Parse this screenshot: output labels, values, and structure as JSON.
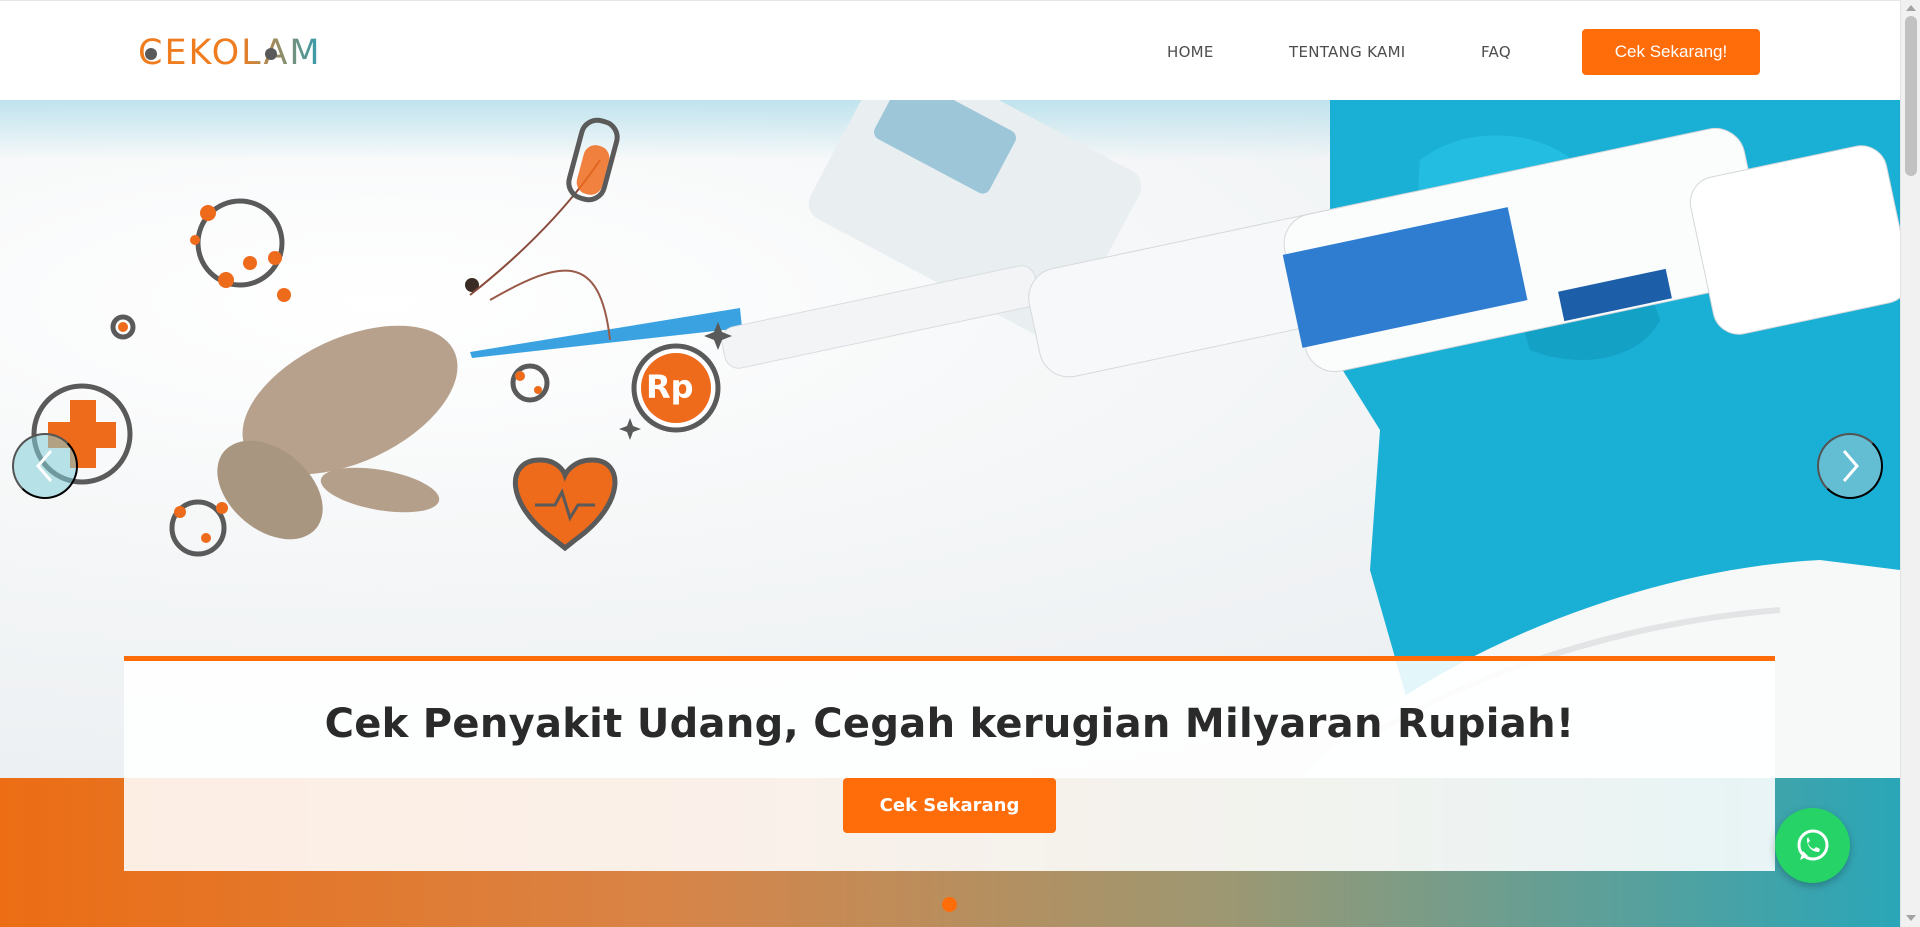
{
  "brand": {
    "logo_text": "CEKOLAM",
    "orange": "#ff6c0a",
    "teal": "#2f9db2"
  },
  "nav": {
    "home": "HOME",
    "about": "TENTANG KAMI",
    "faq": "FAQ",
    "cta": "Cek Sekarang!"
  },
  "hero": {
    "title": "Cek Penyakit Udang, Cegah kerugian Milyaran Rupiah!",
    "cta": "Cek Sekarang",
    "badge_text": "Rp",
    "slides_total": 1,
    "active_slide": 1,
    "prev_icon": "chevron-left-icon",
    "next_icon": "chevron-right-icon"
  },
  "floating": {
    "whatsapp_icon": "whatsapp-icon"
  }
}
